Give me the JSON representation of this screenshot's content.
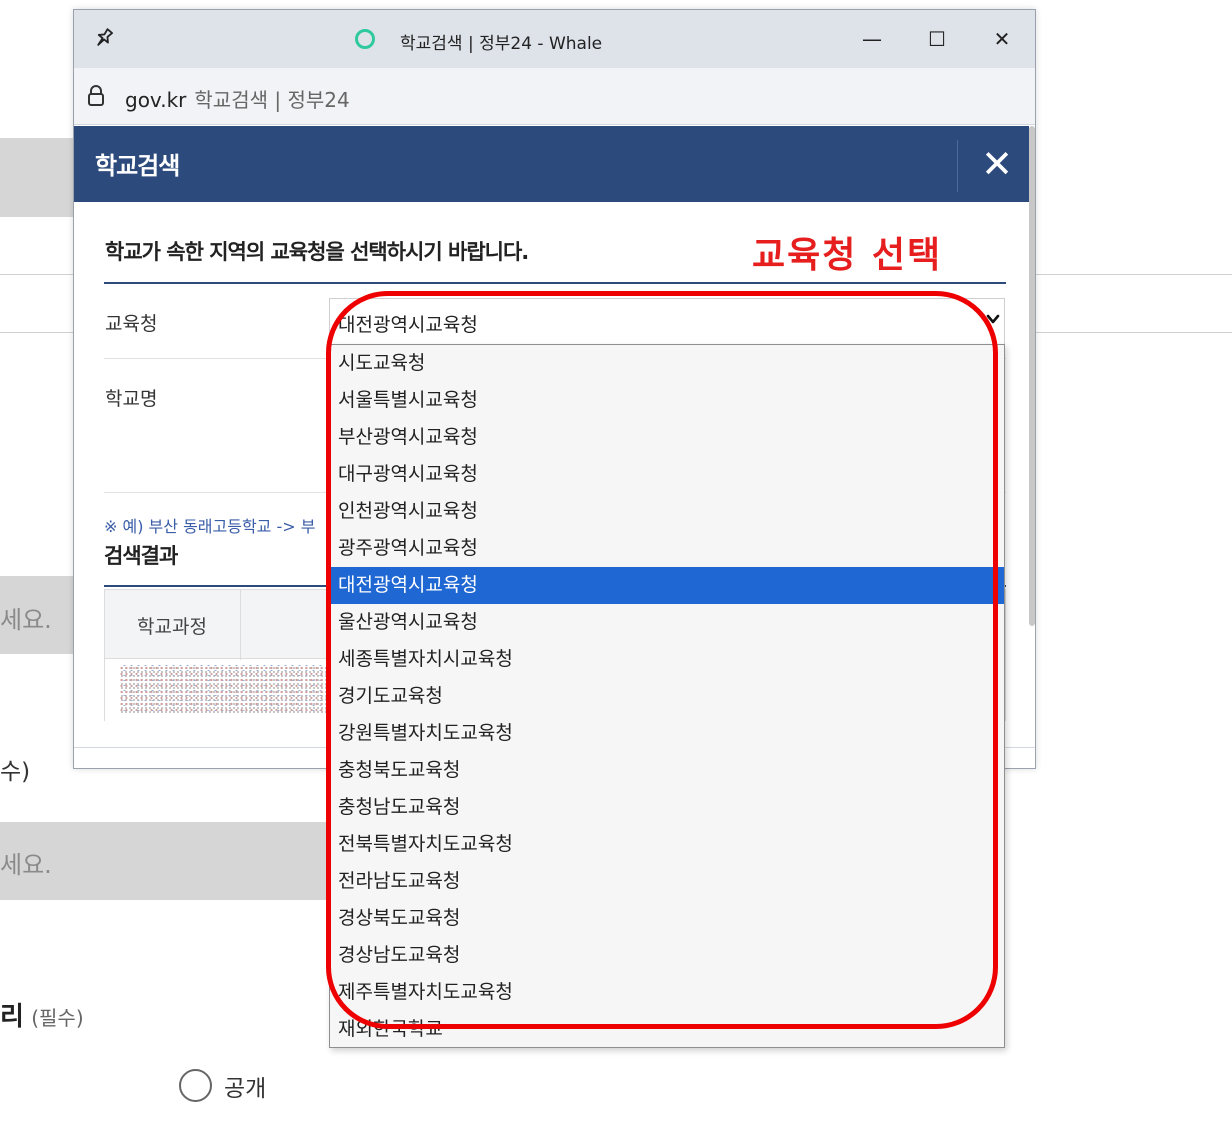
{
  "window": {
    "title": "학교검색 | 정부24 - Whale",
    "minimize_glyph": "—",
    "maximize_glyph": "☐",
    "close_glyph": "✕"
  },
  "address_bar": {
    "domain": "gov.kr",
    "page_title": "학교검색 | 정부24"
  },
  "modal": {
    "title": "학교검색",
    "close_glyph": "✕",
    "instruction": "학교가 속한 지역의 교육청을 선택하시기 바랍니다.",
    "fields": {
      "office_label": "교육청",
      "school_name_label": "학교명"
    },
    "example_hint": "※ 예) 부산 동래고등학교 -> 부",
    "results_title": "검색결과",
    "results_columns": [
      "학교과정"
    ]
  },
  "select": {
    "value": "대전광역시교육청",
    "options": [
      "시도교육청",
      "서울특별시교육청",
      "부산광역시교육청",
      "대구광역시교육청",
      "인천광역시교육청",
      "광주광역시교육청",
      "대전광역시교육청",
      "울산광역시교육청",
      "세종특별자치시교육청",
      "경기도교육청",
      "강원특별자치도교육청",
      "충청북도교육청",
      "충청남도교육청",
      "전북특별자치도교육청",
      "전라남도교육청",
      "경상북도교육청",
      "경상남도교육청",
      "제주특별자치도교육청",
      "재외한국학교"
    ],
    "selected_index": 6,
    "highlight_color": "#1f67d2"
  },
  "annotation": {
    "label": "교육청 선택",
    "color": "#ee0000"
  },
  "background_page": {
    "placeholder_1": "세요.",
    "required_1": "수)",
    "placeholder_2": "세요.",
    "section_tail": "리",
    "section_required": "(필수)",
    "radio_label": "공개"
  },
  "colors": {
    "modal_header": "#2c4a7c",
    "titlebar": "#dee3ea"
  },
  "icons": [
    "pin-icon",
    "whale-logo-icon",
    "minimize-icon",
    "maximize-icon",
    "close-icon",
    "lock-icon",
    "chevron-down-icon",
    "radio-icon"
  ]
}
